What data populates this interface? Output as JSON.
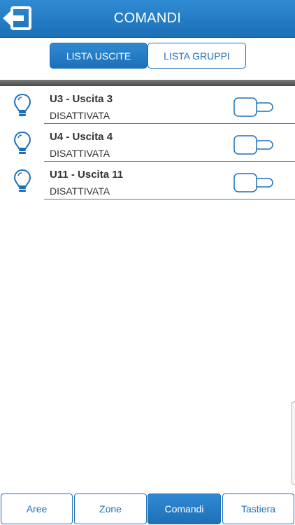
{
  "header": {
    "title": "COMANDI",
    "back_icon": "exit-arrow-icon"
  },
  "segments": {
    "active_label": "LISTA USCITE",
    "inactive_label": "LISTA GRUPPI"
  },
  "outputs": [
    {
      "name": "U3 - Uscita 3",
      "state": "DISATTIVATA",
      "icon": "light-bulb-icon",
      "on": false
    },
    {
      "name": "U4 - Uscita 4",
      "state": "DISATTIVATA",
      "icon": "light-bulb-icon",
      "on": false
    },
    {
      "name": "U11 - Uscita 11",
      "state": "DISATTIVATA",
      "icon": "light-bulb-icon",
      "on": false
    }
  ],
  "tabs": [
    {
      "label": "Aree",
      "active": false
    },
    {
      "label": "Zone",
      "active": false
    },
    {
      "label": "Comandi",
      "active": true
    },
    {
      "label": "Tastiera",
      "active": false
    }
  ],
  "colors": {
    "accent": "#1d70b8",
    "header_top": "#2f8ad2",
    "text": "#333333",
    "divider": "#555555"
  }
}
